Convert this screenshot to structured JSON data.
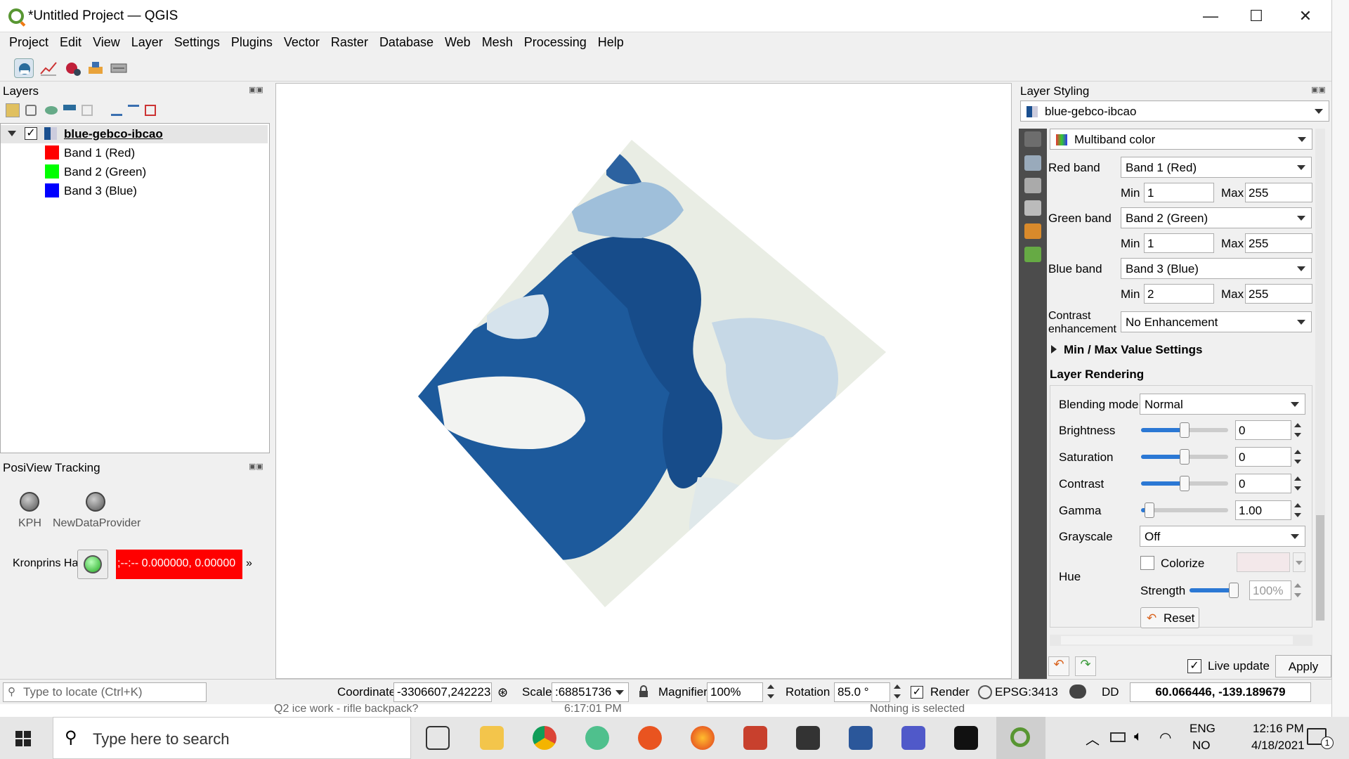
{
  "window": {
    "title": "*Untitled Project — QGIS",
    "minimize_icon": "minimize-icon",
    "maximize_icon": "maximize-icon",
    "close_icon": "close-icon",
    "min_glyph": "—",
    "max_glyph": "☐",
    "close_glyph": "✕"
  },
  "menu": [
    "Project",
    "Edit",
    "View",
    "Layer",
    "Settings",
    "Plugins",
    "Vector",
    "Raster",
    "Database",
    "Web",
    "Mesh",
    "Processing",
    "Help"
  ],
  "layers_panel": {
    "title": "Layers",
    "root_layer": "blue-gebco-ibcao",
    "bands": [
      {
        "label": "Band 1 (Red)",
        "color": "#ff0000"
      },
      {
        "label": "Band 2 (Green)",
        "color": "#00ff00"
      },
      {
        "label": "Band 3 (Blue)",
        "color": "#0000ff"
      }
    ]
  },
  "posiview": {
    "title": "PosiView Tracking",
    "providers": [
      "KPH",
      "NewDataProvider"
    ],
    "vessel_name": "Kronprins Ha",
    "position_text": ";--:-- 0.000000, 0.00000",
    "more": "»",
    "alert_color": "#ff0000"
  },
  "styling": {
    "title": "Layer Styling",
    "layer_select": "blue-gebco-ibcao",
    "renderer": "Multiband color",
    "red_band": {
      "label": "Red band",
      "value": "Band 1 (Red)",
      "min": "1",
      "max": "255"
    },
    "green_band": {
      "label": "Green band",
      "value": "Band 2 (Green)",
      "min": "1",
      "max": "255"
    },
    "blue_band": {
      "label": "Blue band",
      "value": "Band 3 (Blue)",
      "min": "2",
      "max": "255"
    },
    "min_label": "Min",
    "max_label": "Max",
    "contrast_label_1": "Contrast",
    "contrast_label_2": "enhancement",
    "contrast_value": "No Enhancement",
    "minmax_section": "Min / Max Value Settings",
    "rendering_section": "Layer Rendering",
    "blending_label": "Blending mode",
    "blending_value": "Normal",
    "brightness": {
      "label": "Brightness",
      "value": "0",
      "level": 0.5
    },
    "saturation": {
      "label": "Saturation",
      "value": "0",
      "level": 0.5
    },
    "contrast": {
      "label": "Contrast",
      "value": "0",
      "level": 0.5
    },
    "gamma": {
      "label": "Gamma",
      "value": "1.00",
      "level": 0.1
    },
    "grayscale_label": "Grayscale",
    "grayscale_value": "Off",
    "hue_label": "Hue",
    "colorize_label": "Colorize",
    "strength_label": "Strength",
    "strength_value": "100%",
    "strength_level": 1.0,
    "reset_label": "Reset",
    "live_update_label": "Live update",
    "apply_label": "Apply"
  },
  "statusbar": {
    "locate_placeholder": "Type to locate (Ctrl+K)",
    "coordinate_label": "Coordinate",
    "coordinate_value": "-3306607,242223",
    "scale_label": "Scale",
    "scale_value": ":68851736",
    "magnifier_label": "Magnifier",
    "magnifier_value": "100%",
    "rotation_label": "Rotation",
    "rotation_value": "85.0 °",
    "render_label": "Render",
    "crs_label": "EPSG:3413",
    "dd_label": "DD",
    "dd_value": "60.066446, -139.189679"
  },
  "behind_window": {
    "text1": "Q2 ice work - rifle backpack?",
    "text2": "6:17:01 PM",
    "text3": "Nothing is selected"
  },
  "taskbar": {
    "search_placeholder": "Type here to search",
    "lang_top": "ENG",
    "lang_bottom": "NO",
    "time": "12:16 PM",
    "date": "4/18/2021",
    "notif_count": "1"
  }
}
